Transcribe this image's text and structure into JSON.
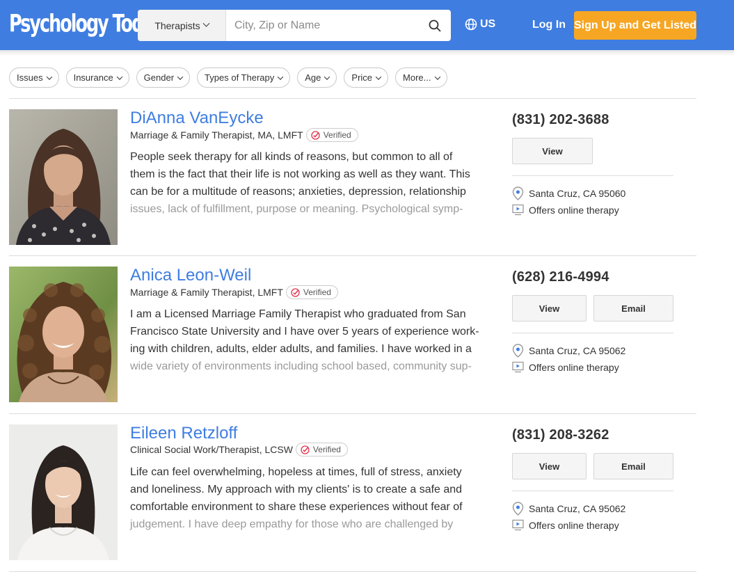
{
  "header": {
    "logo": "Psychology Today",
    "search_type": "Therapists",
    "search_placeholder": "City, Zip or Name",
    "country": "US",
    "login": "Log In",
    "signup": "Sign Up and Get Listed"
  },
  "filters": [
    "Issues",
    "Insurance",
    "Gender",
    "Types of Therapy",
    "Age",
    "Price",
    "More..."
  ],
  "verified_label": "Verified",
  "results": [
    {
      "name": "DiAnna VanEycke",
      "credentials": "Marriage & Family Therapist, MA, LMFT",
      "bio": [
        "People seek therapy for all kinds of reasons, but common to all of",
        "them is the fact that their life is not working as well as they want. This",
        "can be for a multitude of reasons; anxieties, depression, relationship",
        "issues, lack of fulfillment, purpose or meaning. Psychological symp-"
      ],
      "phone": "(831) 202-3688",
      "view_label": "View",
      "location": "Santa Cruz, CA 95060",
      "online": "Offers online therapy"
    },
    {
      "name": "Anica Leon-Weil",
      "credentials": "Marriage & Family Therapist, LMFT",
      "bio": [
        "I am a Licensed Marriage Family Therapist who graduated from San",
        "Francisco State University and I have over 5 years of experience work-",
        "ing with children, adults, elder adults, and families. I have worked in a",
        "wide variety of environments including school based, community sup-"
      ],
      "phone": "(628) 216-4994",
      "view_label": "View",
      "email_label": "Email",
      "location": "Santa Cruz, CA 95062",
      "online": "Offers online therapy"
    },
    {
      "name": "Eileen Retzloff",
      "credentials": "Clinical Social Work/Therapist, LCSW",
      "bio": [
        "Life can feel overwhelming, hopeless at times, full of stress, anxiety",
        "and loneliness. My approach with my clients' is to create a safe and",
        "comfortable environment to share these experiences without fear of",
        "judgement. I have deep empathy for those who are challenged by"
      ],
      "phone": "(831) 208-3262",
      "view_label": "View",
      "email_label": "Email",
      "location": "Santa Cruz, CA 95062",
      "online": "Offers online therapy"
    }
  ],
  "colors": {
    "brand_blue": "#3f7de1",
    "signup_orange": "#f6a623",
    "verified_red": "#e0344d"
  }
}
